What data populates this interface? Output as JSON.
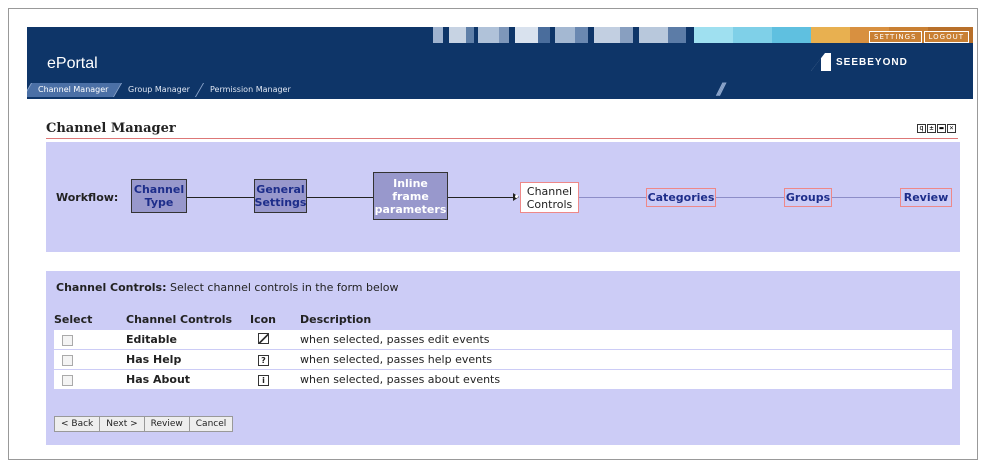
{
  "header": {
    "app_title": "ePortal",
    "links": [
      "SETTINGS",
      "LOGOUT"
    ],
    "logo_text": "SEEBEYOND",
    "nav_tabs": [
      {
        "label": "Channel Manager",
        "active": true
      },
      {
        "label": "Group Manager",
        "active": false
      },
      {
        "label": "Permission Manager",
        "active": false
      }
    ],
    "colors": {
      "bg": "#0e3568",
      "accent": "#c98033"
    }
  },
  "page": {
    "title": "Channel Manager",
    "window_icons": [
      "zoom-icon",
      "minimize-icon",
      "restore-icon",
      "close-icon"
    ]
  },
  "workflow": {
    "label": "Workflow:",
    "steps": [
      {
        "label": "Channel Type",
        "state": "done"
      },
      {
        "label": "General Settings",
        "state": "done"
      },
      {
        "label": "Inline frame parameters",
        "state": "done"
      },
      {
        "label": "Channel Controls",
        "state": "current"
      },
      {
        "label": "Categories",
        "state": "todo"
      },
      {
        "label": "Groups",
        "state": "todo"
      },
      {
        "label": "Review",
        "state": "todo"
      }
    ]
  },
  "form": {
    "intro_bold": "Channel Controls:",
    "intro_text": " Select channel controls in the form below",
    "columns": [
      "Select",
      "Channel Controls",
      "Icon",
      "Description"
    ],
    "rows": [
      {
        "name": "Editable",
        "icon": "edit-icon",
        "description": "when selected, passes edit events",
        "checked": false
      },
      {
        "name": "Has Help",
        "icon": "help-icon",
        "description": "when selected, passes help events",
        "checked": false
      },
      {
        "name": "Has About",
        "icon": "about-icon",
        "description": "when selected, passes about events",
        "checked": false
      }
    ],
    "buttons": [
      "< Back",
      "Next >",
      "Review",
      "Cancel"
    ]
  }
}
